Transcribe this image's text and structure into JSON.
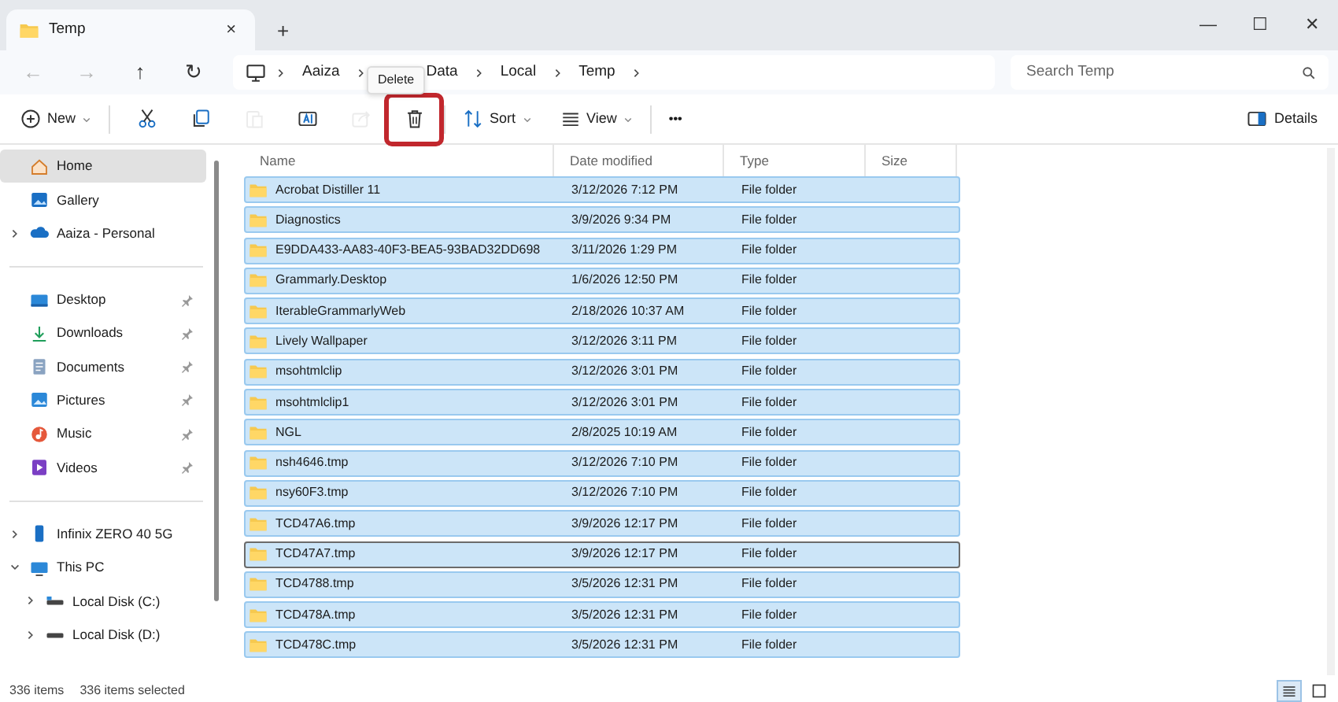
{
  "tab": {
    "title": "Temp",
    "close": "×",
    "new_tab": "+"
  },
  "window_controls": {
    "minimize": "—",
    "maximize": "☐",
    "close": "✕"
  },
  "nav": {
    "back": {
      "label": "←",
      "disabled": true
    },
    "forward": {
      "label": "→",
      "disabled": true
    },
    "up": {
      "label": "↑",
      "disabled": false
    },
    "refresh": {
      "label": "↻",
      "disabled": false
    }
  },
  "breadcrumbs": [
    "Aaiza",
    "Data",
    "Local",
    "Temp"
  ],
  "search": {
    "placeholder": "Search Temp"
  },
  "toolbar": [
    {
      "kind": "menu",
      "label": "New",
      "disabled": false,
      "highlighted": false
    },
    {
      "kind": "icon",
      "disabled": false,
      "highlighted": false
    },
    {
      "kind": "icon",
      "disabled": false,
      "highlighted": false
    },
    {
      "kind": "icon",
      "disabled": true,
      "highlighted": false
    },
    {
      "kind": "icon",
      "disabled": false,
      "highlighted": false
    },
    {
      "kind": "icon",
      "disabled": true,
      "highlighted": false
    },
    {
      "kind": "icon",
      "disabled": false,
      "highlighted": true
    },
    {
      "kind": "menu",
      "label": "Sort",
      "disabled": false,
      "highlighted": false
    },
    {
      "kind": "menu",
      "label": "View",
      "disabled": false,
      "highlighted": false
    },
    {
      "kind": "more",
      "label": "•••",
      "disabled": false,
      "highlighted": false
    }
  ],
  "tooltip": "Delete",
  "details_button": "Details",
  "sidebar": [
    [
      {
        "label": "Home",
        "selected": true,
        "pinned": false
      },
      {
        "label": "Gallery",
        "selected": false,
        "pinned": false
      },
      {
        "label": "Aaiza - Personal",
        "selected": false,
        "pinned": false,
        "expanded": false
      }
    ],
    [
      {
        "label": "Desktop",
        "selected": false,
        "pinned": true
      },
      {
        "label": "Downloads",
        "selected": false,
        "pinned": true
      },
      {
        "label": "Documents",
        "selected": false,
        "pinned": true
      },
      {
        "label": "Pictures",
        "selected": false,
        "pinned": true
      },
      {
        "label": "Music",
        "selected": false,
        "pinned": true
      },
      {
        "label": "Videos",
        "selected": false,
        "pinned": true
      }
    ],
    [
      {
        "label": "Infinix ZERO 40 5G",
        "selected": false,
        "pinned": false,
        "expanded": false
      },
      {
        "label": "This PC",
        "selected": false,
        "pinned": false,
        "expanded": true,
        "children": [
          {
            "label": "Local Disk (C:)",
            "selected": false,
            "pinned": false,
            "expanded": false
          },
          {
            "label": "Local Disk (D:)",
            "selected": false,
            "pinned": false,
            "expanded": false
          }
        ]
      }
    ]
  ],
  "table": {
    "columns": [
      "Name",
      "Date modified",
      "Type",
      "Size"
    ],
    "rows": [
      {
        "name": "Acrobat Distiller 11",
        "date": "3/12/2026 7:12 PM",
        "type": "File folder",
        "selected": true,
        "focused": false
      },
      {
        "name": "Diagnostics",
        "date": "3/9/2026 9:34 PM",
        "type": "File folder",
        "selected": true,
        "focused": false
      },
      {
        "name": "E9DDA433-AA83-40F3-BEA5-93BAD32DD698",
        "date": "3/11/2026 1:29 PM",
        "type": "File folder",
        "selected": true,
        "focused": false
      },
      {
        "name": "Grammarly.Desktop",
        "date": "1/6/2026 12:50 PM",
        "type": "File folder",
        "selected": true,
        "focused": false
      },
      {
        "name": "IterableGrammarlyWeb",
        "date": "2/18/2026 10:37 AM",
        "type": "File folder",
        "selected": true,
        "focused": false
      },
      {
        "name": "Lively Wallpaper",
        "date": "3/12/2026 3:11 PM",
        "type": "File folder",
        "selected": true,
        "focused": false
      },
      {
        "name": "msohtmlclip",
        "date": "3/12/2026 3:01 PM",
        "type": "File folder",
        "selected": true,
        "focused": false
      },
      {
        "name": "msohtmlclip1",
        "date": "3/12/2026 3:01 PM",
        "type": "File folder",
        "selected": true,
        "focused": false
      },
      {
        "name": "NGL",
        "date": "2/8/2025 10:19 AM",
        "type": "File folder",
        "selected": true,
        "focused": false
      },
      {
        "name": "nsh4646.tmp",
        "date": "3/12/2026 7:10 PM",
        "type": "File folder",
        "selected": true,
        "focused": false
      },
      {
        "name": "nsy60F3.tmp",
        "date": "3/12/2026 7:10 PM",
        "type": "File folder",
        "selected": true,
        "focused": false
      },
      {
        "name": "TCD47A6.tmp",
        "date": "3/9/2026 12:17 PM",
        "type": "File folder",
        "selected": true,
        "focused": false
      },
      {
        "name": "TCD47A7.tmp",
        "date": "3/9/2026 12:17 PM",
        "type": "File folder",
        "selected": true,
        "focused": true
      },
      {
        "name": "TCD4788.tmp",
        "date": "3/5/2026 12:31 PM",
        "type": "File folder",
        "selected": true,
        "focused": false
      },
      {
        "name": "TCD478A.tmp",
        "date": "3/5/2026 12:31 PM",
        "type": "File folder",
        "selected": true,
        "focused": false
      },
      {
        "name": "TCD478C.tmp",
        "date": "3/5/2026 12:31 PM",
        "type": "File folder",
        "selected": true,
        "focused": false
      }
    ]
  },
  "status_bar": {
    "count": "336 items",
    "selection": "336 items selected",
    "views": [
      {
        "selected": true
      },
      {
        "selected": false
      }
    ]
  }
}
